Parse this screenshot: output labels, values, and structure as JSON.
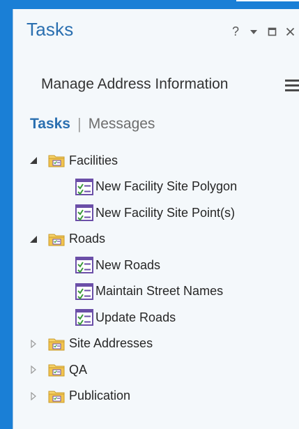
{
  "pane": {
    "title": "Tasks",
    "controls": {
      "help": "?",
      "options": "options-dropdown-icon",
      "maximize": "maximize-icon",
      "close": "close-icon"
    }
  },
  "project": {
    "name": "Manage Address Information",
    "menu_icon": "hamburger-menu-icon"
  },
  "tabs": {
    "tasks": "Tasks",
    "separator": "|",
    "messages": "Messages"
  },
  "tree": {
    "groups": [
      {
        "label": "Facilities",
        "expanded": true,
        "items": [
          "New Facility Site Polygon",
          "New Facility Site Point(s)"
        ]
      },
      {
        "label": "Roads",
        "expanded": true,
        "items": [
          "New Roads",
          "Maintain Street Names",
          "Update Roads"
        ]
      },
      {
        "label": "Site Addresses",
        "expanded": false,
        "items": []
      },
      {
        "label": "QA",
        "expanded": false,
        "items": []
      },
      {
        "label": "Publication",
        "expanded": false,
        "items": []
      }
    ]
  },
  "colors": {
    "accent": "#2a6fb0",
    "frame_blue": "#1a7fd6",
    "folder": "#f2c44e",
    "task_icon": "#6b4fa8",
    "task_check": "#3c9a3c"
  }
}
